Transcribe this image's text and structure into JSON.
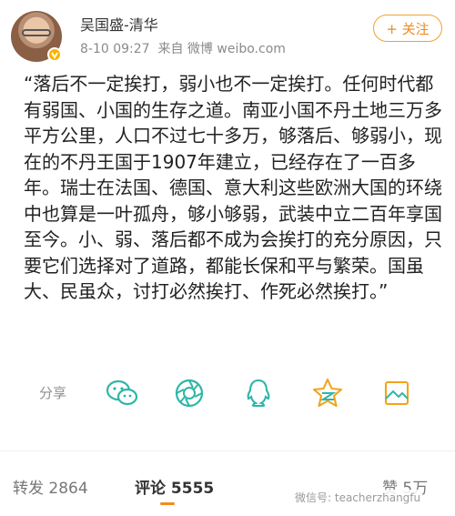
{
  "user": {
    "name": "吴国盛-清华",
    "time": "8-10 09:27",
    "source": "来自 微博 weibo.com",
    "follow_label": "+ 关注"
  },
  "post": {
    "text": "“落后不一定挨打，弱小也不一定挨打。任何时代都有弱国、小国的生存之道。南亚小国不丹土地三万多平方公里，人口不过七十多万，够落后、够弱小，现在的不丹王国于1907年建立，已经存在了一百多年。瑞士在法国、德国、意大利这些欧洲大国的环绕中也算是一叶孤舟，够小够弱，武装中立二百年享国至今。小、弱、落后都不成为会挨打的充分原因，只要它们选择对了道路，都能长保和平与繁荣。国虽大、民虽众，讨打必然挨打、作死必然挨打。”"
  },
  "share": {
    "label": "分享",
    "icons": [
      "wechat-icon",
      "moments-icon",
      "qq-icon",
      "qzone-star-icon",
      "image-share-icon"
    ]
  },
  "stats": {
    "repost": "转发 2864",
    "comment": "评论 5555",
    "like": "赞 5万"
  },
  "watermark": "微信号: teacherzhangfu",
  "colors": {
    "accent": "#f28c1c",
    "icon_teal": "#2fb6a8"
  }
}
